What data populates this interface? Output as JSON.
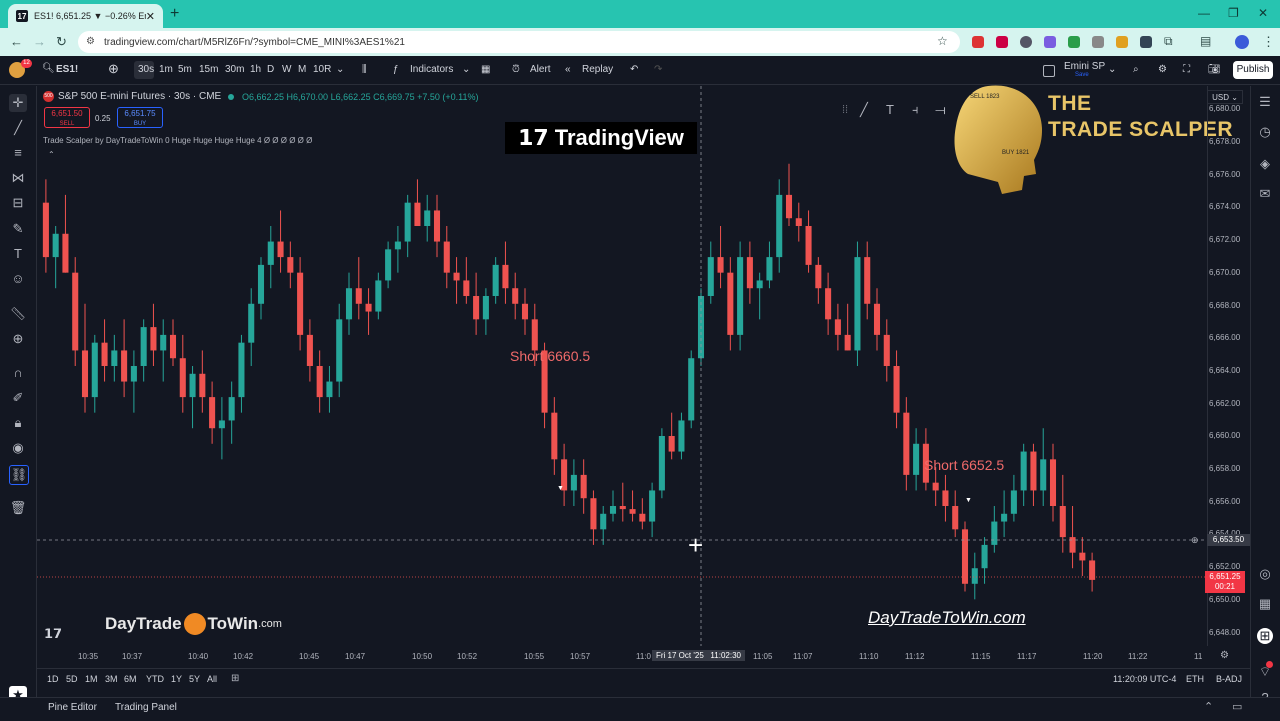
{
  "browser": {
    "tab_title": "ES1! 6,651.25 ▼ −0.26% Emini ...",
    "url": "tradingview.com/chart/M5RlZ6Fn/?symbol=CME_MINI%3AES1%21"
  },
  "toolbar": {
    "symbol": "ES1!",
    "intervals": [
      "30s",
      "1m",
      "5m",
      "15m",
      "30m",
      "1h",
      "D",
      "W",
      "M",
      "10R"
    ],
    "active_interval": "30s",
    "indicators": "Indicators",
    "alert": "Alert",
    "replay": "Replay",
    "layout_name": "Emini SP",
    "layout_sub": "Save",
    "publish": "Publish",
    "avatar_badge": "12"
  },
  "legend": {
    "title": "S&P 500 E-mini Futures · 30s · CME",
    "ohlc": "O6,662.25  H6,670.00  L6,662.25  C6,669.75  +7.50 (+0.11%)",
    "sell_price": "6,651.50",
    "sell_label": "SELL",
    "spread": "0.25",
    "buy_price": "6,651.75",
    "buy_label": "BUY",
    "indicator": "Trade Scalper by DayTradeToWin 0 Huge Huge Huge Huge 4  Ø  Ø  Ø  Ø  Ø  Ø"
  },
  "watermark": "TradingView",
  "logo": {
    "line1": "THE",
    "line2": "TRADE SCALPER",
    "sell": "SELL 1823",
    "buy": "BUY 1821"
  },
  "annotations": [
    {
      "text": "Short 6660.5",
      "price": 6665.5,
      "time": "10:55"
    },
    {
      "text": "Short 6652.5",
      "price": 6657.5,
      "time": "11:15"
    }
  ],
  "branding": {
    "dttw_left_a": "DayTrade",
    "dttw_left_b": "ToWin",
    "dttw_left_c": ".com",
    "dttw_right": "DayTradeToWin.com"
  },
  "price_axis": {
    "currency": "USD",
    "ticks": [
      "6,678.00",
      "6,676.00",
      "6,674.00",
      "6,672.00",
      "6,670.00",
      "6,668.00",
      "6,666.00",
      "6,664.00",
      "6,662.00",
      "6,660.00",
      "6,658.00",
      "6,656.00",
      "6,654.00",
      "6,652.00",
      "6,650.00",
      "6,648.00"
    ],
    "crosshair_price": "6,653.50",
    "last_price": "6,651.25",
    "countdown": "00:21",
    "top_partial": "6,680.00"
  },
  "time_axis": {
    "ticks": [
      "10:35",
      "10:37",
      "10:40",
      "10:42",
      "10:45",
      "10:47",
      "10:50",
      "10:52",
      "10:55",
      "10:57",
      "11:0",
      "11:05",
      "11:07",
      "11:10",
      "11:12",
      "11:15",
      "11:17",
      "11:20",
      "11:22",
      "11"
    ],
    "crosshair_time": "Fri 17 Oct '25   11:02:30"
  },
  "bottom": {
    "ranges": [
      "1D",
      "5D",
      "1M",
      "3M",
      "6M",
      "YTD",
      "1Y",
      "5Y",
      "All"
    ],
    "clock": "11:20:09 UTC-4",
    "session": "ETH",
    "adj": "B-ADJ"
  },
  "panels": {
    "pine": "Pine Editor",
    "trading": "Trading Panel"
  },
  "chart_data": {
    "type": "candlestick",
    "colors": {
      "up": "#26a69a",
      "down": "#ef5350"
    },
    "ylim": [
      6647,
      6683
    ],
    "candles": [
      [
        6675.5,
        6677,
        6671,
        6672
      ],
      [
        6672,
        6674,
        6670,
        6673.5
      ],
      [
        6673.5,
        6676,
        6671,
        6671
      ],
      [
        6671,
        6672,
        6665,
        6666
      ],
      [
        6666,
        6669,
        6662,
        6663
      ],
      [
        6663,
        6667,
        6662,
        6666.5
      ],
      [
        6666.5,
        6668,
        6664,
        6665
      ],
      [
        6665,
        6667,
        6664,
        6666
      ],
      [
        6666,
        6668,
        6663,
        6664
      ],
      [
        6664,
        6666,
        6662,
        6665
      ],
      [
        6665,
        6668,
        6664,
        6667.5
      ],
      [
        6667.5,
        6669,
        6665,
        6666
      ],
      [
        6666,
        6668,
        6664,
        6667
      ],
      [
        6667,
        6668,
        6665,
        6665.5
      ],
      [
        6665.5,
        6667,
        6662,
        6663
      ],
      [
        6663,
        6665,
        6661,
        6664.5
      ],
      [
        6664.5,
        6666,
        6662,
        6663
      ],
      [
        6663,
        6664,
        6660,
        6661
      ],
      [
        6661,
        6663,
        6659,
        6661.5
      ],
      [
        6661.5,
        6664,
        6660,
        6663
      ],
      [
        6663,
        6667,
        6662,
        6666.5
      ],
      [
        6666.5,
        6670,
        6665,
        6669
      ],
      [
        6669,
        6672,
        6668,
        6671.5
      ],
      [
        6671.5,
        6674,
        6670,
        6673
      ],
      [
        6673,
        6675,
        6671,
        6672
      ],
      [
        6672,
        6673,
        6670,
        6671
      ],
      [
        6671,
        6672,
        6666,
        6667
      ],
      [
        6667,
        6668,
        6664,
        6665
      ],
      [
        6665,
        6666,
        6662,
        6663
      ],
      [
        6663,
        6665,
        6662,
        6664
      ],
      [
        6664,
        6669,
        6663,
        6668
      ],
      [
        6668,
        6671,
        6667,
        6670
      ],
      [
        6670,
        6672,
        6668,
        6669
      ],
      [
        6669,
        6670,
        6667,
        6668.5
      ],
      [
        6668.5,
        6671,
        6668,
        6670.5
      ],
      [
        6670.5,
        6673,
        6670,
        6672.5
      ],
      [
        6672.5,
        6674,
        6671,
        6673
      ],
      [
        6673,
        6676,
        6672,
        6675.5
      ],
      [
        6675.5,
        6677,
        6674,
        6674
      ],
      [
        6674,
        6676,
        6673,
        6675
      ],
      [
        6675,
        6676,
        6672,
        6673
      ],
      [
        6673,
        6674,
        6670,
        6671
      ],
      [
        6671,
        6672,
        6669,
        6670.5
      ],
      [
        6670.5,
        6672,
        6669,
        6669.5
      ],
      [
        6669.5,
        6671,
        6667,
        6668
      ],
      [
        6668,
        6670,
        6667,
        6669.5
      ],
      [
        6669.5,
        6672,
        6669,
        6671.5
      ],
      [
        6671.5,
        6673,
        6669,
        6670
      ],
      [
        6670,
        6671,
        6668,
        6669
      ],
      [
        6669,
        6670,
        6667,
        6668
      ],
      [
        6668,
        6669,
        6665,
        6666
      ],
      [
        6666,
        6666.5,
        6661,
        6662
      ],
      [
        6662,
        6663,
        6658,
        6659
      ],
      [
        6659,
        6660,
        6656,
        6657
      ],
      [
        6657,
        6659,
        6656,
        6658
      ],
      [
        6658,
        6659,
        6655.5,
        6656.5
      ],
      [
        6656.5,
        6657,
        6653.5,
        6654.5
      ],
      [
        6654.5,
        6656,
        6653.5,
        6655.5
      ],
      [
        6655.5,
        6657,
        6655,
        6656
      ],
      [
        6656,
        6657.5,
        6655,
        6655.8
      ],
      [
        6655.8,
        6657,
        6655,
        6655.5
      ],
      [
        6655.5,
        6656.5,
        6654.5,
        6655
      ],
      [
        6655,
        6657.5,
        6654,
        6657
      ],
      [
        6657,
        6661,
        6656.5,
        6660.5
      ],
      [
        6660.5,
        6662,
        6659,
        6659.5
      ],
      [
        6659.5,
        6662,
        6659,
        6661.5
      ],
      [
        6661.5,
        6666,
        6661,
        6665.5
      ],
      [
        6665.5,
        6670,
        6665,
        6669.5
      ],
      [
        6669.5,
        6673,
        6669,
        6672
      ],
      [
        6672,
        6674,
        6670,
        6671
      ],
      [
        6671,
        6672,
        6666,
        6667
      ],
      [
        6667,
        6673,
        6666,
        6672
      ],
      [
        6672,
        6673,
        6669,
        6670
      ],
      [
        6670,
        6671,
        6668,
        6670.5
      ],
      [
        6670.5,
        6673,
        6670,
        6672
      ],
      [
        6672,
        6677,
        6671,
        6676
      ],
      [
        6676,
        6678,
        6674,
        6674.5
      ],
      [
        6674.5,
        6675.5,
        6673,
        6674
      ],
      [
        6674,
        6675,
        6671,
        6671.5
      ],
      [
        6671.5,
        6672,
        6669,
        6670
      ],
      [
        6670,
        6671,
        6667,
        6668
      ],
      [
        6668,
        6669,
        6666,
        6667
      ],
      [
        6667,
        6669,
        6666,
        6666
      ],
      [
        6666,
        6673,
        6665,
        6672
      ],
      [
        6672,
        6673,
        6668,
        6669
      ],
      [
        6669,
        6670,
        6666,
        6667
      ],
      [
        6667,
        6668,
        6664,
        6665
      ],
      [
        6665,
        6666,
        6661,
        6662
      ],
      [
        6662,
        6663,
        6657,
        6658
      ],
      [
        6658,
        6661,
        6657,
        6660
      ],
      [
        6660,
        6661,
        6657,
        6657.5
      ],
      [
        6657.5,
        6658.5,
        6656,
        6657
      ],
      [
        6657,
        6658,
        6655,
        6656
      ],
      [
        6656,
        6657,
        6654,
        6654.5
      ],
      [
        6654.5,
        6655,
        6650.5,
        6651
      ],
      [
        6651,
        6653,
        6650,
        6652
      ],
      [
        6652,
        6654,
        6651,
        6653.5
      ],
      [
        6653.5,
        6656,
        6653,
        6655
      ],
      [
        6655,
        6657,
        6654,
        6655.5
      ],
      [
        6655.5,
        6658,
        6655,
        6657
      ],
      [
        6657,
        6660,
        6656,
        6659.5
      ],
      [
        6659.5,
        6660,
        6656,
        6657
      ],
      [
        6657,
        6661,
        6656,
        6659
      ],
      [
        6659,
        6660,
        6655,
        6656
      ],
      [
        6656,
        6658,
        6653,
        6654
      ],
      [
        6654,
        6656,
        6652,
        6653
      ],
      [
        6653,
        6654,
        6651.5,
        6652.5
      ],
      [
        6652.5,
        6653,
        6650.5,
        6651.25
      ]
    ]
  }
}
